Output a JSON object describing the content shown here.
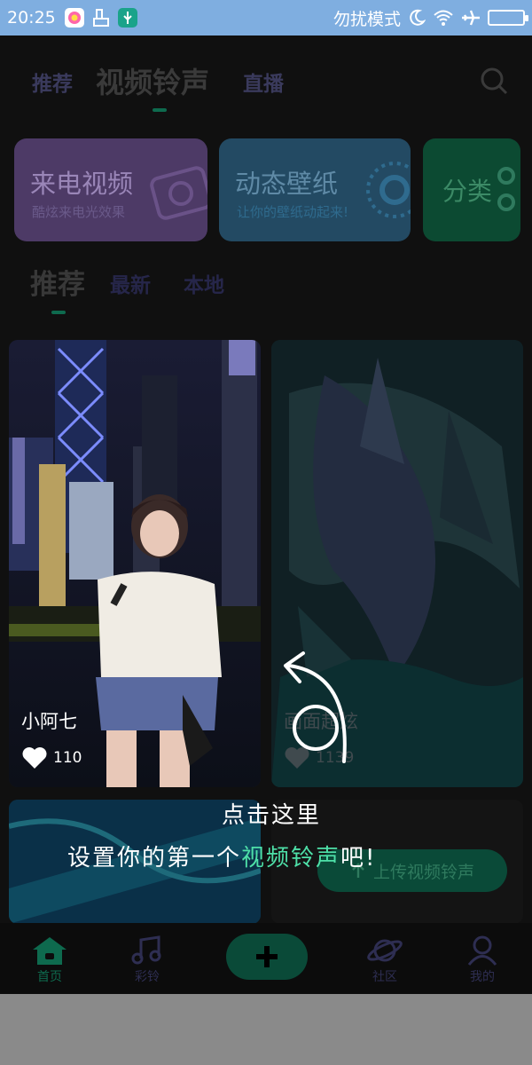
{
  "status_bar": {
    "time": "20:25",
    "dnd_text": "勿扰模式"
  },
  "top_nav": {
    "tabs": [
      "推荐",
      "视频铃声",
      "直播"
    ],
    "active_tab": "视频铃声"
  },
  "feature_cards": [
    {
      "title": "来电视频",
      "subtitle": "酷炫来电光效果"
    },
    {
      "title": "动态壁纸",
      "subtitle": "让你的壁纸动起来!"
    },
    {
      "title": "分类",
      "subtitle": ""
    }
  ],
  "sub_tabs": {
    "items": [
      "推荐",
      "最新",
      "本地"
    ],
    "active": "推荐"
  },
  "posts": [
    {
      "caption": "小阿七",
      "likes": "110"
    },
    {
      "caption": "画面超炫",
      "likes": "1139"
    }
  ],
  "upload_button": {
    "label": "上传视频铃声"
  },
  "tutorial": {
    "line1": "点击这里",
    "line2_prefix": "设置你的第一个",
    "line2_highlight": "视频铃声",
    "line2_suffix": "吧!"
  },
  "bottom_nav": {
    "items": [
      "首页",
      "彩铃",
      "社区",
      "我的"
    ]
  },
  "colors": {
    "status_bar": "#7faee0",
    "accent_green": "#0e6a4e",
    "highlight_text": "#4ee0a8",
    "background": "#101010"
  }
}
